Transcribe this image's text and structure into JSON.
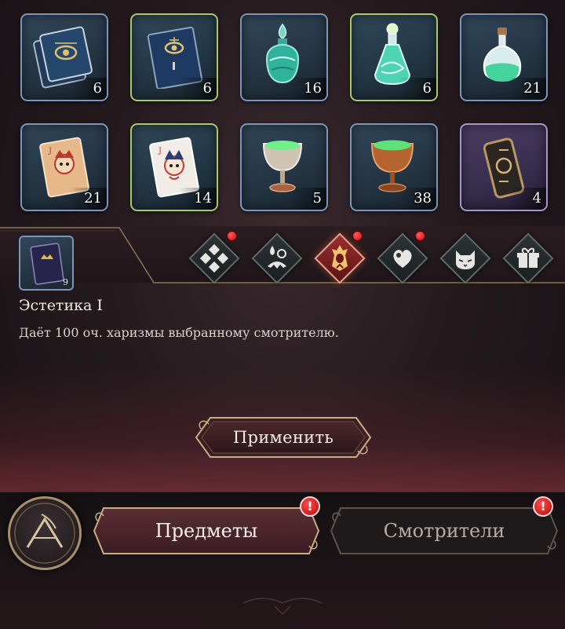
{
  "inventory": {
    "items": [
      {
        "name": "blue-tome",
        "count": "6",
        "frame": "blue"
      },
      {
        "name": "blue-book",
        "count": "6",
        "frame": "green"
      },
      {
        "name": "teal-potion-flask",
        "count": "16",
        "frame": "blue"
      },
      {
        "name": "green-swirl-potion",
        "count": "6",
        "frame": "green"
      },
      {
        "name": "green-round-potion",
        "count": "21",
        "frame": "blue"
      },
      {
        "name": "jester-card-gold",
        "count": "21",
        "frame": "blue"
      },
      {
        "name": "jester-card-white",
        "count": "14",
        "frame": "green"
      },
      {
        "name": "goblet-silver",
        "count": "5",
        "frame": "blue"
      },
      {
        "name": "goblet-bronze",
        "count": "38",
        "frame": "blue"
      },
      {
        "name": "ornate-talisman",
        "count": "4",
        "frame": "purple"
      }
    ]
  },
  "selected": {
    "count": "9",
    "title": "Эстетика I",
    "description": "Даёт 100 оч. харизмы выбранному смотрителю."
  },
  "filters": [
    {
      "name": "all-filter",
      "badge": true,
      "active": false
    },
    {
      "name": "potion-filter",
      "badge": false,
      "active": false
    },
    {
      "name": "charisma-filter",
      "badge": true,
      "active": true
    },
    {
      "name": "heart-filter",
      "badge": true,
      "active": false
    },
    {
      "name": "cat-filter",
      "badge": false,
      "active": false
    },
    {
      "name": "box-filter",
      "badge": false,
      "active": false
    }
  ],
  "actions": {
    "apply_label": "Применить"
  },
  "nav": {
    "items_tab": "Предметы",
    "keepers_tab": "Смотрители",
    "alert_mark": "!"
  },
  "colors": {
    "frame_blue": "#7f95b8",
    "frame_green": "#a9c86a",
    "frame_purple": "#a996c8",
    "accent_red": "#9c2e2e",
    "gold_trim": "#a88f6e"
  }
}
